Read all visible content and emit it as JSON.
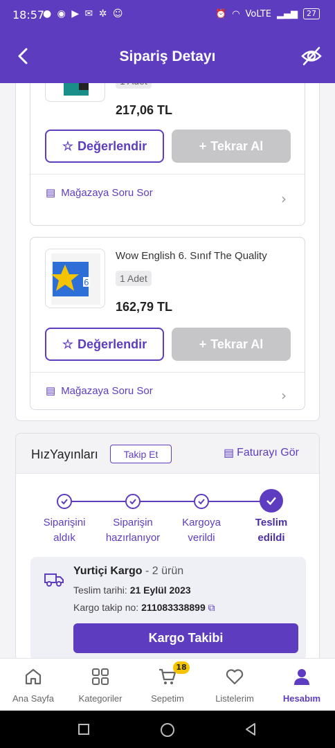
{
  "status_bar": {
    "time": "18:57",
    "network": "VoLTE",
    "battery": "27"
  },
  "header": {
    "title": "Sipariş Detayı"
  },
  "items": [
    {
      "title": "",
      "quantity": "1 Adet",
      "price": "217,06 TL",
      "rate_label": "Değerlendir",
      "buy_again_label": "Tekrar Al",
      "ask_label": "Mağazaya Soru Sor"
    },
    {
      "title": "Wow English 6. Sınıf The Quality",
      "quantity": "1 Adet",
      "price": "162,79 TL",
      "rate_label": "Değerlendir",
      "buy_again_label": "Tekrar Al",
      "ask_label": "Mağazaya Soru Sor"
    }
  ],
  "seller": {
    "name": "HızYayınları",
    "follow_label": "Takip Et",
    "invoice_label": "Faturayı Gör"
  },
  "tracking_steps": [
    {
      "line1": "Siparişini",
      "line2": "aldık"
    },
    {
      "line1": "Siparişin",
      "line2": "hazırlanıyor"
    },
    {
      "line1": "Kargoya",
      "line2": "verildi"
    },
    {
      "line1": "Teslim",
      "line2": "edildi"
    }
  ],
  "cargo": {
    "company": "Yurtiçi Kargo",
    "count": "- 2 ürün",
    "delivery_prefix": "Teslim tarihi:",
    "delivery_date": "21 Eylül 2023",
    "tracking_prefix": "Kargo takip no:",
    "tracking_no": "211083338899",
    "button_label": "Kargo Takibi"
  },
  "bottom_nav": [
    {
      "label": "Ana Sayfa"
    },
    {
      "label": "Kategoriler"
    },
    {
      "label": "Sepetim",
      "badge": "18"
    },
    {
      "label": "Listelerim"
    },
    {
      "label": "Hesabım"
    }
  ],
  "colors": {
    "primary": "#5e3cbf",
    "disabled": "#c6c6c9",
    "badge": "#f5c400"
  }
}
